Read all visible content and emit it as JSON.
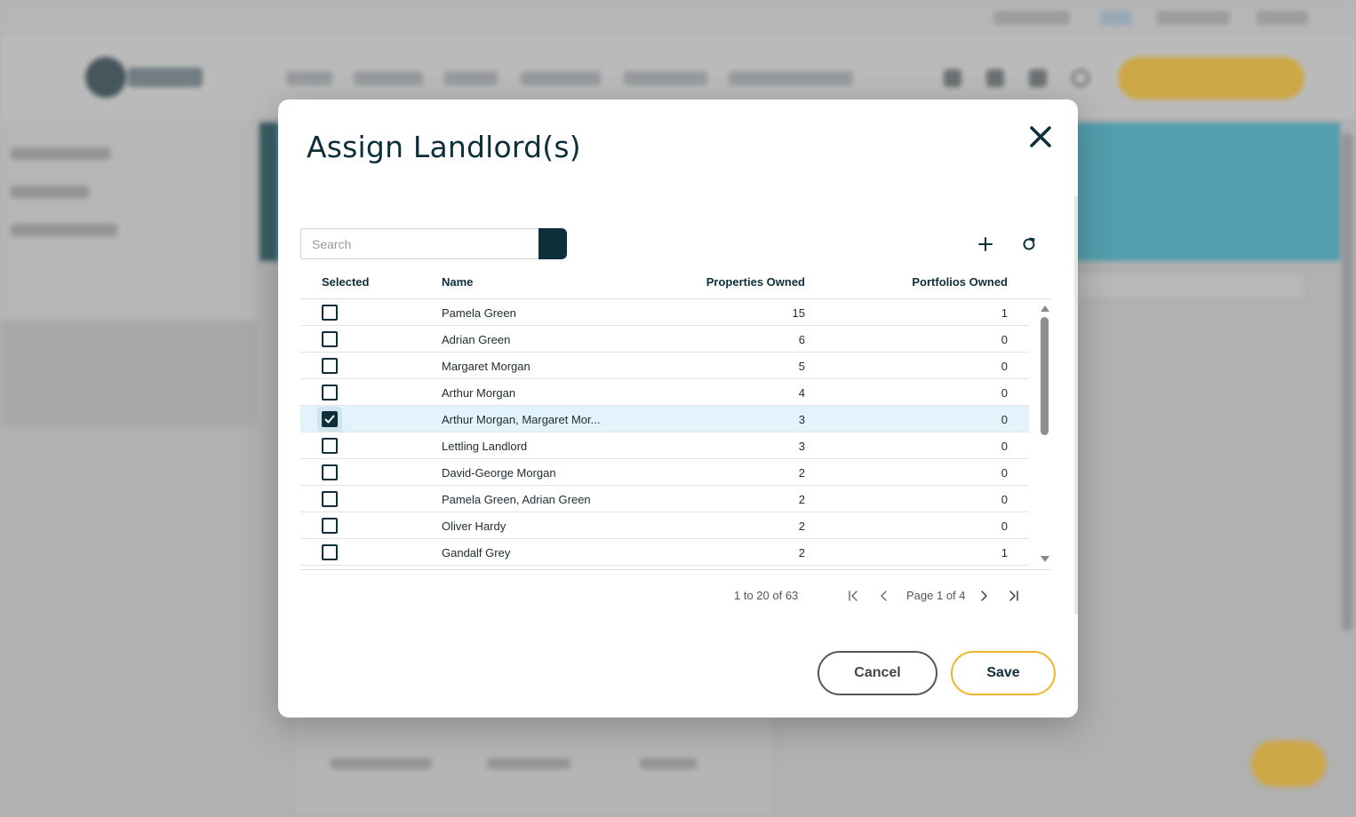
{
  "modal": {
    "title": "Assign Landlord(s)",
    "search_placeholder": "Search",
    "cancel_label": "Cancel",
    "save_label": "Save"
  },
  "grid": {
    "headers": {
      "selected": "Selected",
      "name": "Name",
      "properties": "Properties Owned",
      "portfolios": "Portfolios Owned"
    },
    "rows": [
      {
        "checked": false,
        "name": "Pamela Green",
        "properties": "15",
        "portfolios": "1"
      },
      {
        "checked": false,
        "name": "Adrian Green",
        "properties": "6",
        "portfolios": "0"
      },
      {
        "checked": false,
        "name": "Margaret Morgan",
        "properties": "5",
        "portfolios": "0"
      },
      {
        "checked": false,
        "name": "Arthur Morgan",
        "properties": "4",
        "portfolios": "0"
      },
      {
        "checked": true,
        "name": "Arthur Morgan, Margaret Mor...",
        "properties": "3",
        "portfolios": "0"
      },
      {
        "checked": false,
        "name": "Lettling Landlord",
        "properties": "3",
        "portfolios": "0"
      },
      {
        "checked": false,
        "name": "David-George Morgan",
        "properties": "2",
        "portfolios": "0"
      },
      {
        "checked": false,
        "name": "Pamela Green, Adrian Green",
        "properties": "2",
        "portfolios": "0"
      },
      {
        "checked": false,
        "name": "Oliver Hardy",
        "properties": "2",
        "portfolios": "0"
      },
      {
        "checked": false,
        "name": "Gandalf Grey",
        "properties": "2",
        "portfolios": "1"
      }
    ]
  },
  "pagination": {
    "summary": "1 to 20 of 63",
    "page_label": "Page 1 of 4"
  },
  "icons": {
    "close": "close-icon",
    "search": "search-icon",
    "add": "plus-icon",
    "refresh": "refresh-icon",
    "first": "first-page-icon",
    "prev": "chevron-left-icon",
    "next": "chevron-right-icon",
    "last": "last-page-icon"
  },
  "colors": {
    "primary": "#0d2f3a",
    "accent": "#f0b429",
    "selected_row": "#e3f3fb"
  }
}
